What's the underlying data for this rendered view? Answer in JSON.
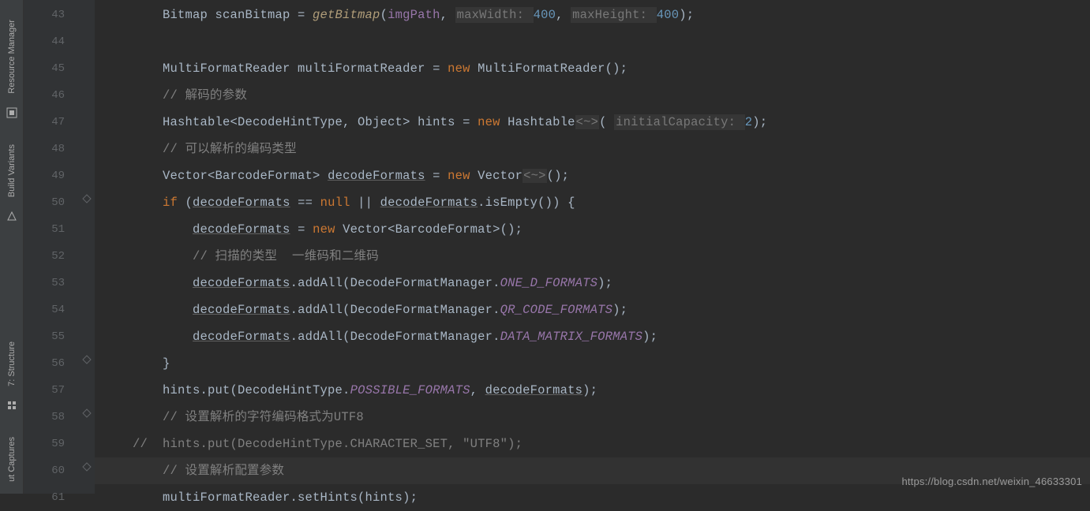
{
  "leftBar": {
    "items": [
      {
        "label": "Resource Manager",
        "iconName": "resource-manager-icon"
      },
      {
        "label": "Build Variants",
        "iconName": "build-variants-icon"
      },
      {
        "label": "7: Structure",
        "iconName": "structure-icon"
      },
      {
        "label": "ut Captures",
        "iconName": "captures-icon"
      }
    ]
  },
  "gutter": {
    "lineNumbers": [
      "43",
      "44",
      "45",
      "46",
      "47",
      "48",
      "49",
      "50",
      "51",
      "52",
      "53",
      "54",
      "55",
      "56",
      "57",
      "58",
      "59",
      "60",
      "61"
    ],
    "foldMarks": {
      "50": "minus-down",
      "56": "minus-up",
      "58": "fold-closed",
      "60": "fold-closed"
    }
  },
  "code": {
    "l43": {
      "indent": "        ",
      "t1": "Bitmap scanBitmap = ",
      "fn": "getBitmap",
      "t2": "(",
      "p1": "imgPath",
      "t3": ", ",
      "hint1": "maxWidth: ",
      "n1": "400",
      "t4": ", ",
      "hint2": "maxHeight: ",
      "n2": "400",
      "t5": ");"
    },
    "l44": {
      "text": ""
    },
    "l45": {
      "indent": "        ",
      "t1": "MultiFormatReader multiFormatReader = ",
      "k": "new",
      "t2": " MultiFormatReader();"
    },
    "l46": {
      "indent": "        ",
      "c": "// 解码的参数"
    },
    "l47": {
      "indent": "        ",
      "t1": "Hashtable<DecodeHintType, Object> hints = ",
      "k": "new",
      "t2": " Hashtable",
      "diamond": "<~>",
      "t3": "( ",
      "hint": "initialCapacity: ",
      "n": "2",
      "t4": ");"
    },
    "l48": {
      "indent": "        ",
      "c": "// 可以解析的编码类型"
    },
    "l49": {
      "indent": "        ",
      "t1": "Vector<BarcodeFormat> ",
      "ul": "decodeFormats",
      "t2": " = ",
      "k": "new",
      "t3": " Vector",
      "diamond": "<~>",
      "t4": "();"
    },
    "l50": {
      "indent": "        ",
      "k1": "if",
      "t1": " (",
      "ul1": "decodeFormats",
      "t2": " == ",
      "k2": "null",
      "t3": " || ",
      "ul2": "decodeFormats",
      "t4": ".isEmpty()) {"
    },
    "l51": {
      "indent": "            ",
      "ul": "decodeFormats",
      "t1": " = ",
      "k": "new",
      "t2": " Vector<BarcodeFormat>();"
    },
    "l52": {
      "indent": "            ",
      "c": "// 扫描的类型  一维码和二维码"
    },
    "l53": {
      "indent": "            ",
      "ul": "decodeFormats",
      "t1": ".addAll(DecodeFormatManager.",
      "ita": "ONE_D_FORMATS",
      "t2": ");"
    },
    "l54": {
      "indent": "            ",
      "ul": "decodeFormats",
      "t1": ".addAll(DecodeFormatManager.",
      "ita": "QR_CODE_FORMATS",
      "t2": ");"
    },
    "l55": {
      "indent": "            ",
      "ul": "decodeFormats",
      "t1": ".addAll(DecodeFormatManager.",
      "ita": "DATA_MATRIX_FORMATS",
      "t2": ");"
    },
    "l56": {
      "indent": "        ",
      "t": "}"
    },
    "l57": {
      "indent": "        ",
      "t1": "hints.put(DecodeHintType.",
      "ita": "POSSIBLE_FORMATS",
      "t2": ", ",
      "ul": "decodeFormats",
      "t3": ");"
    },
    "l58": {
      "indent": "        ",
      "c": "// 设置解析的字符编码格式为UTF8"
    },
    "l59": {
      "indent": "    ",
      "c": "//  hints.put(DecodeHintType.CHARACTER_SET, \"UTF8\");"
    },
    "l60": {
      "indent": "        ",
      "c": "// 设置解析配置参数"
    },
    "l61": {
      "indent": "        ",
      "t": "multiFormatReader.setHints(hints);"
    }
  },
  "watermark": "https://blog.csdn.net/weixin_46633301"
}
